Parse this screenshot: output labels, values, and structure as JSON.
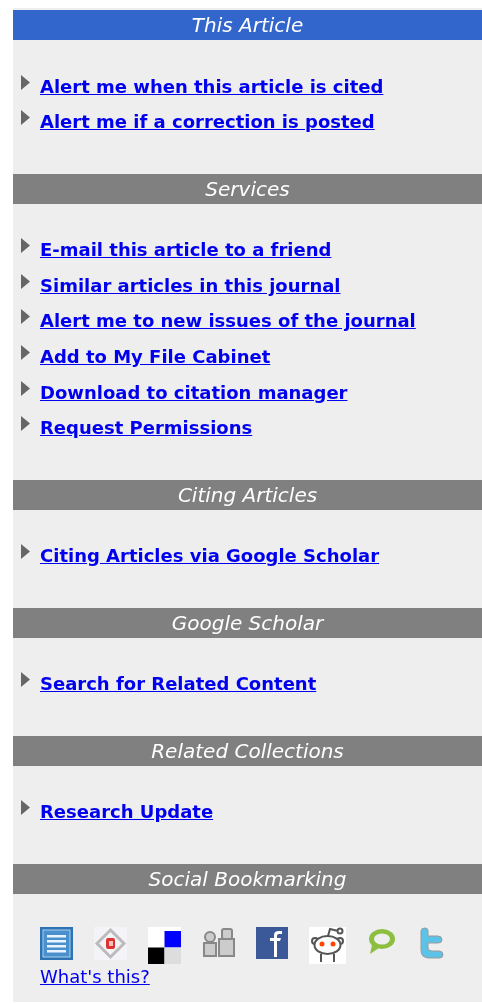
{
  "sections": [
    {
      "kind": "links",
      "title": "This Article",
      "highlighted": true,
      "links": [
        "Alert me when this article is cited",
        "Alert me if a correction is posted"
      ]
    },
    {
      "kind": "links",
      "title": "Services",
      "highlighted": false,
      "links": [
        "E-mail this article to a friend",
        "Similar articles in this journal",
        "Alert me to new issues of the journal",
        "Add to My File Cabinet",
        "Download to citation manager",
        "Request Permissions"
      ]
    },
    {
      "kind": "links",
      "title": "Citing Articles",
      "highlighted": false,
      "links": [
        "Citing Articles via Google Scholar"
      ]
    },
    {
      "kind": "links",
      "title": "Google Scholar",
      "highlighted": false,
      "links": [
        "Search for Related Content"
      ]
    },
    {
      "kind": "links",
      "title": "Related Collections",
      "highlighted": false,
      "links": [
        "Research Update"
      ]
    },
    {
      "kind": "bookmarks",
      "title": "Social Bookmarking",
      "highlighted": false,
      "help_link": "What's this?"
    }
  ]
}
